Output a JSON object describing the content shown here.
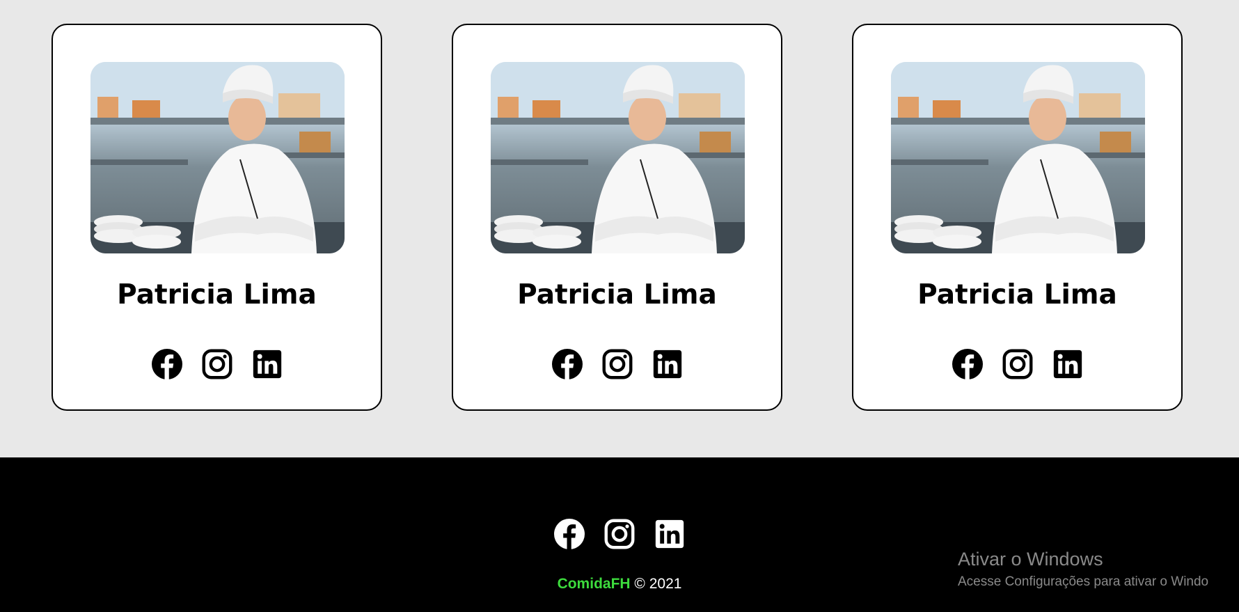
{
  "cards": [
    {
      "name": "Patricia Lima",
      "socials": [
        "facebook-icon",
        "instagram-icon",
        "linkedin-icon"
      ]
    },
    {
      "name": "Patricia Lima",
      "socials": [
        "facebook-icon",
        "instagram-icon",
        "linkedin-icon"
      ]
    },
    {
      "name": "Patricia Lima",
      "socials": [
        "facebook-icon",
        "instagram-icon",
        "linkedin-icon"
      ]
    }
  ],
  "footer": {
    "socials": [
      "facebook-icon",
      "instagram-icon",
      "linkedin-icon"
    ],
    "brand": "ComidaFH",
    "copyright": "© 2021"
  },
  "watermark": {
    "title": "Ativar o Windows",
    "subtitle": "Acesse Configurações para ativar o Windo"
  },
  "colors": {
    "page_background": "#e8e8e8",
    "card_background": "#ffffff",
    "footer_background": "#000000",
    "brand": "#3ddc3d"
  }
}
